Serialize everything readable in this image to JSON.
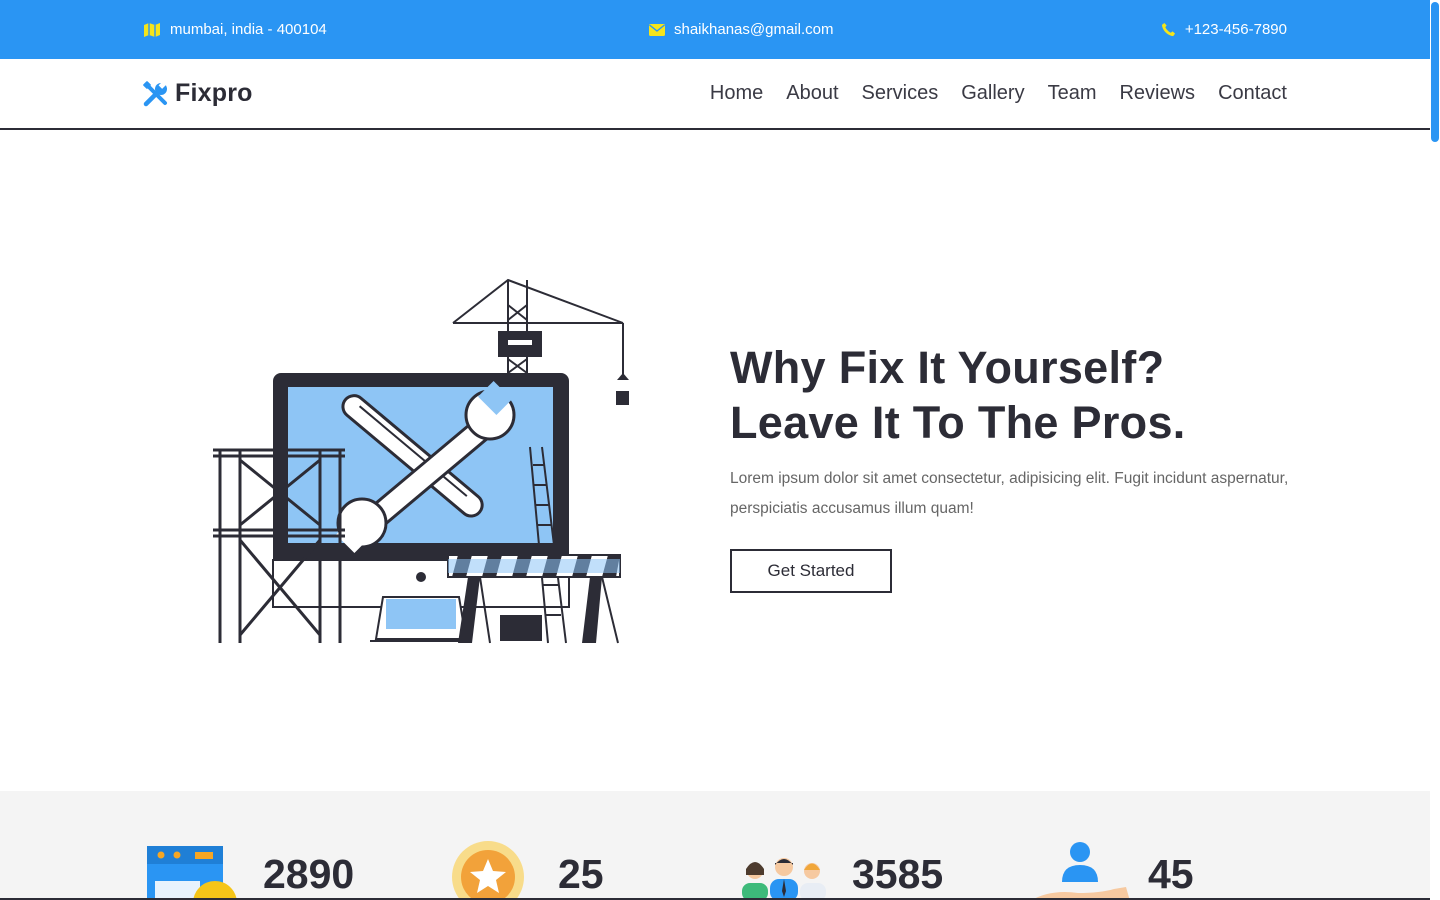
{
  "topbar": {
    "address": "mumbai, india - 400104",
    "email": "shaikhanas@gmail.com",
    "phone": "+123-456-7890",
    "icon_color": "#f5e51b"
  },
  "brand": {
    "name": "Fixpro",
    "color": "#2a95f3"
  },
  "nav": {
    "items": [
      "Home",
      "About",
      "Services",
      "Gallery",
      "Team",
      "Reviews",
      "Contact"
    ]
  },
  "hero": {
    "title_line1": "Why Fix It Yourself?",
    "title_line2": "Leave It To The Pros.",
    "subtitle": "Lorem ipsum dolor sit amet consectetur, adipisicing elit. Fugit incidunt aspernatur, perspiciatis accusamus illum quam!",
    "cta": "Get Started"
  },
  "stats": [
    {
      "value": "2890",
      "icon": "calendar-icon"
    },
    {
      "value": "25",
      "icon": "award-badge-icon"
    },
    {
      "value": "3585",
      "icon": "team-people-icon"
    },
    {
      "value": "45",
      "icon": "hand-user-icon"
    }
  ],
  "colors": {
    "primary": "#2a95f3",
    "dark": "#2c2c36",
    "light_blue": "#8ec5f5"
  }
}
